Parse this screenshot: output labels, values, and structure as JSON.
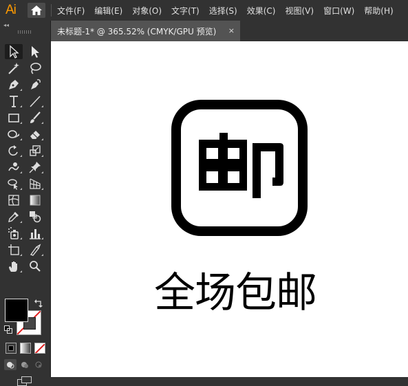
{
  "app": {
    "logo": "Ai"
  },
  "menu": {
    "items": [
      "文件(F)",
      "编辑(E)",
      "对象(O)",
      "文字(T)",
      "选择(S)",
      "效果(C)",
      "视图(V)",
      "窗口(W)",
      "帮助(H)"
    ]
  },
  "document": {
    "tab_title": "未标题-1* @ 365.52% (CMYK/GPU 预览)",
    "close_glyph": "×"
  },
  "artwork": {
    "badge_character": "邮",
    "headline": "全场包邮"
  },
  "colors": {
    "accent": "#ff9a00",
    "fill": "#000000",
    "stroke": "none"
  },
  "tools": [
    "selection-tool",
    "direct-selection-tool",
    "magic-wand-tool",
    "lasso-tool",
    "pen-tool",
    "curvature-tool",
    "type-tool",
    "line-segment-tool",
    "rectangle-tool",
    "paintbrush-tool",
    "shaper-tool",
    "eraser-tool",
    "rotate-tool",
    "scale-tool",
    "warp-tool",
    "puppet-warp-tool",
    "shape-builder-tool",
    "perspective-grid-tool",
    "mesh-tool",
    "gradient-tool",
    "eyedropper-tool",
    "blend-tool",
    "symbol-sprayer-tool",
    "column-graph-tool",
    "artboard-tool",
    "slice-tool",
    "hand-tool",
    "zoom-tool"
  ]
}
